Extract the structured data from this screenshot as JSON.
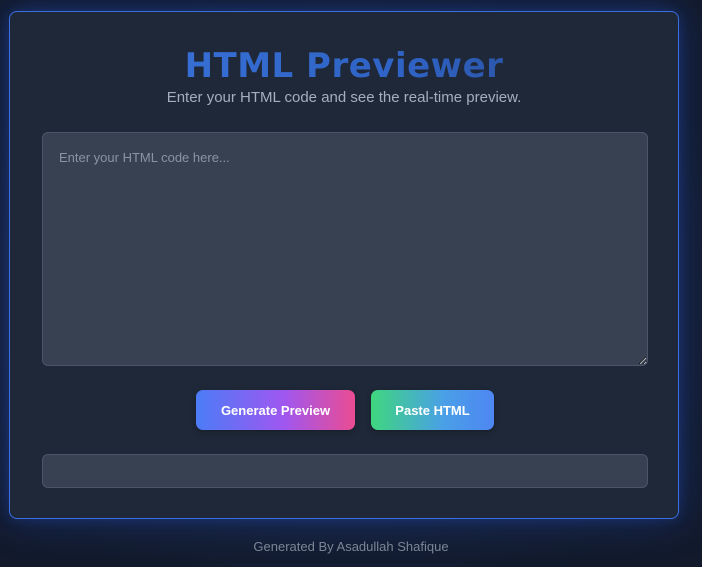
{
  "header": {
    "title": "HTML Previewer",
    "subtitle": "Enter your HTML code and see the real-time preview."
  },
  "editor": {
    "placeholder": "Enter your HTML code here...",
    "value": ""
  },
  "actions": {
    "generate_label": "Generate Preview",
    "paste_label": "Paste HTML"
  },
  "preview": {
    "content": ""
  },
  "footer": {
    "text": "Generated By Asadullah Shafique"
  },
  "colors": {
    "accent": "#3b6fe0",
    "card_background": "#1f2838",
    "field_background": "#384152",
    "generate_gradient": [
      "#4b7cf7",
      "#9f57f0",
      "#ea4c92"
    ],
    "paste_gradient": [
      "#3fd67f",
      "#4a9fe8",
      "#4e86f2"
    ]
  }
}
